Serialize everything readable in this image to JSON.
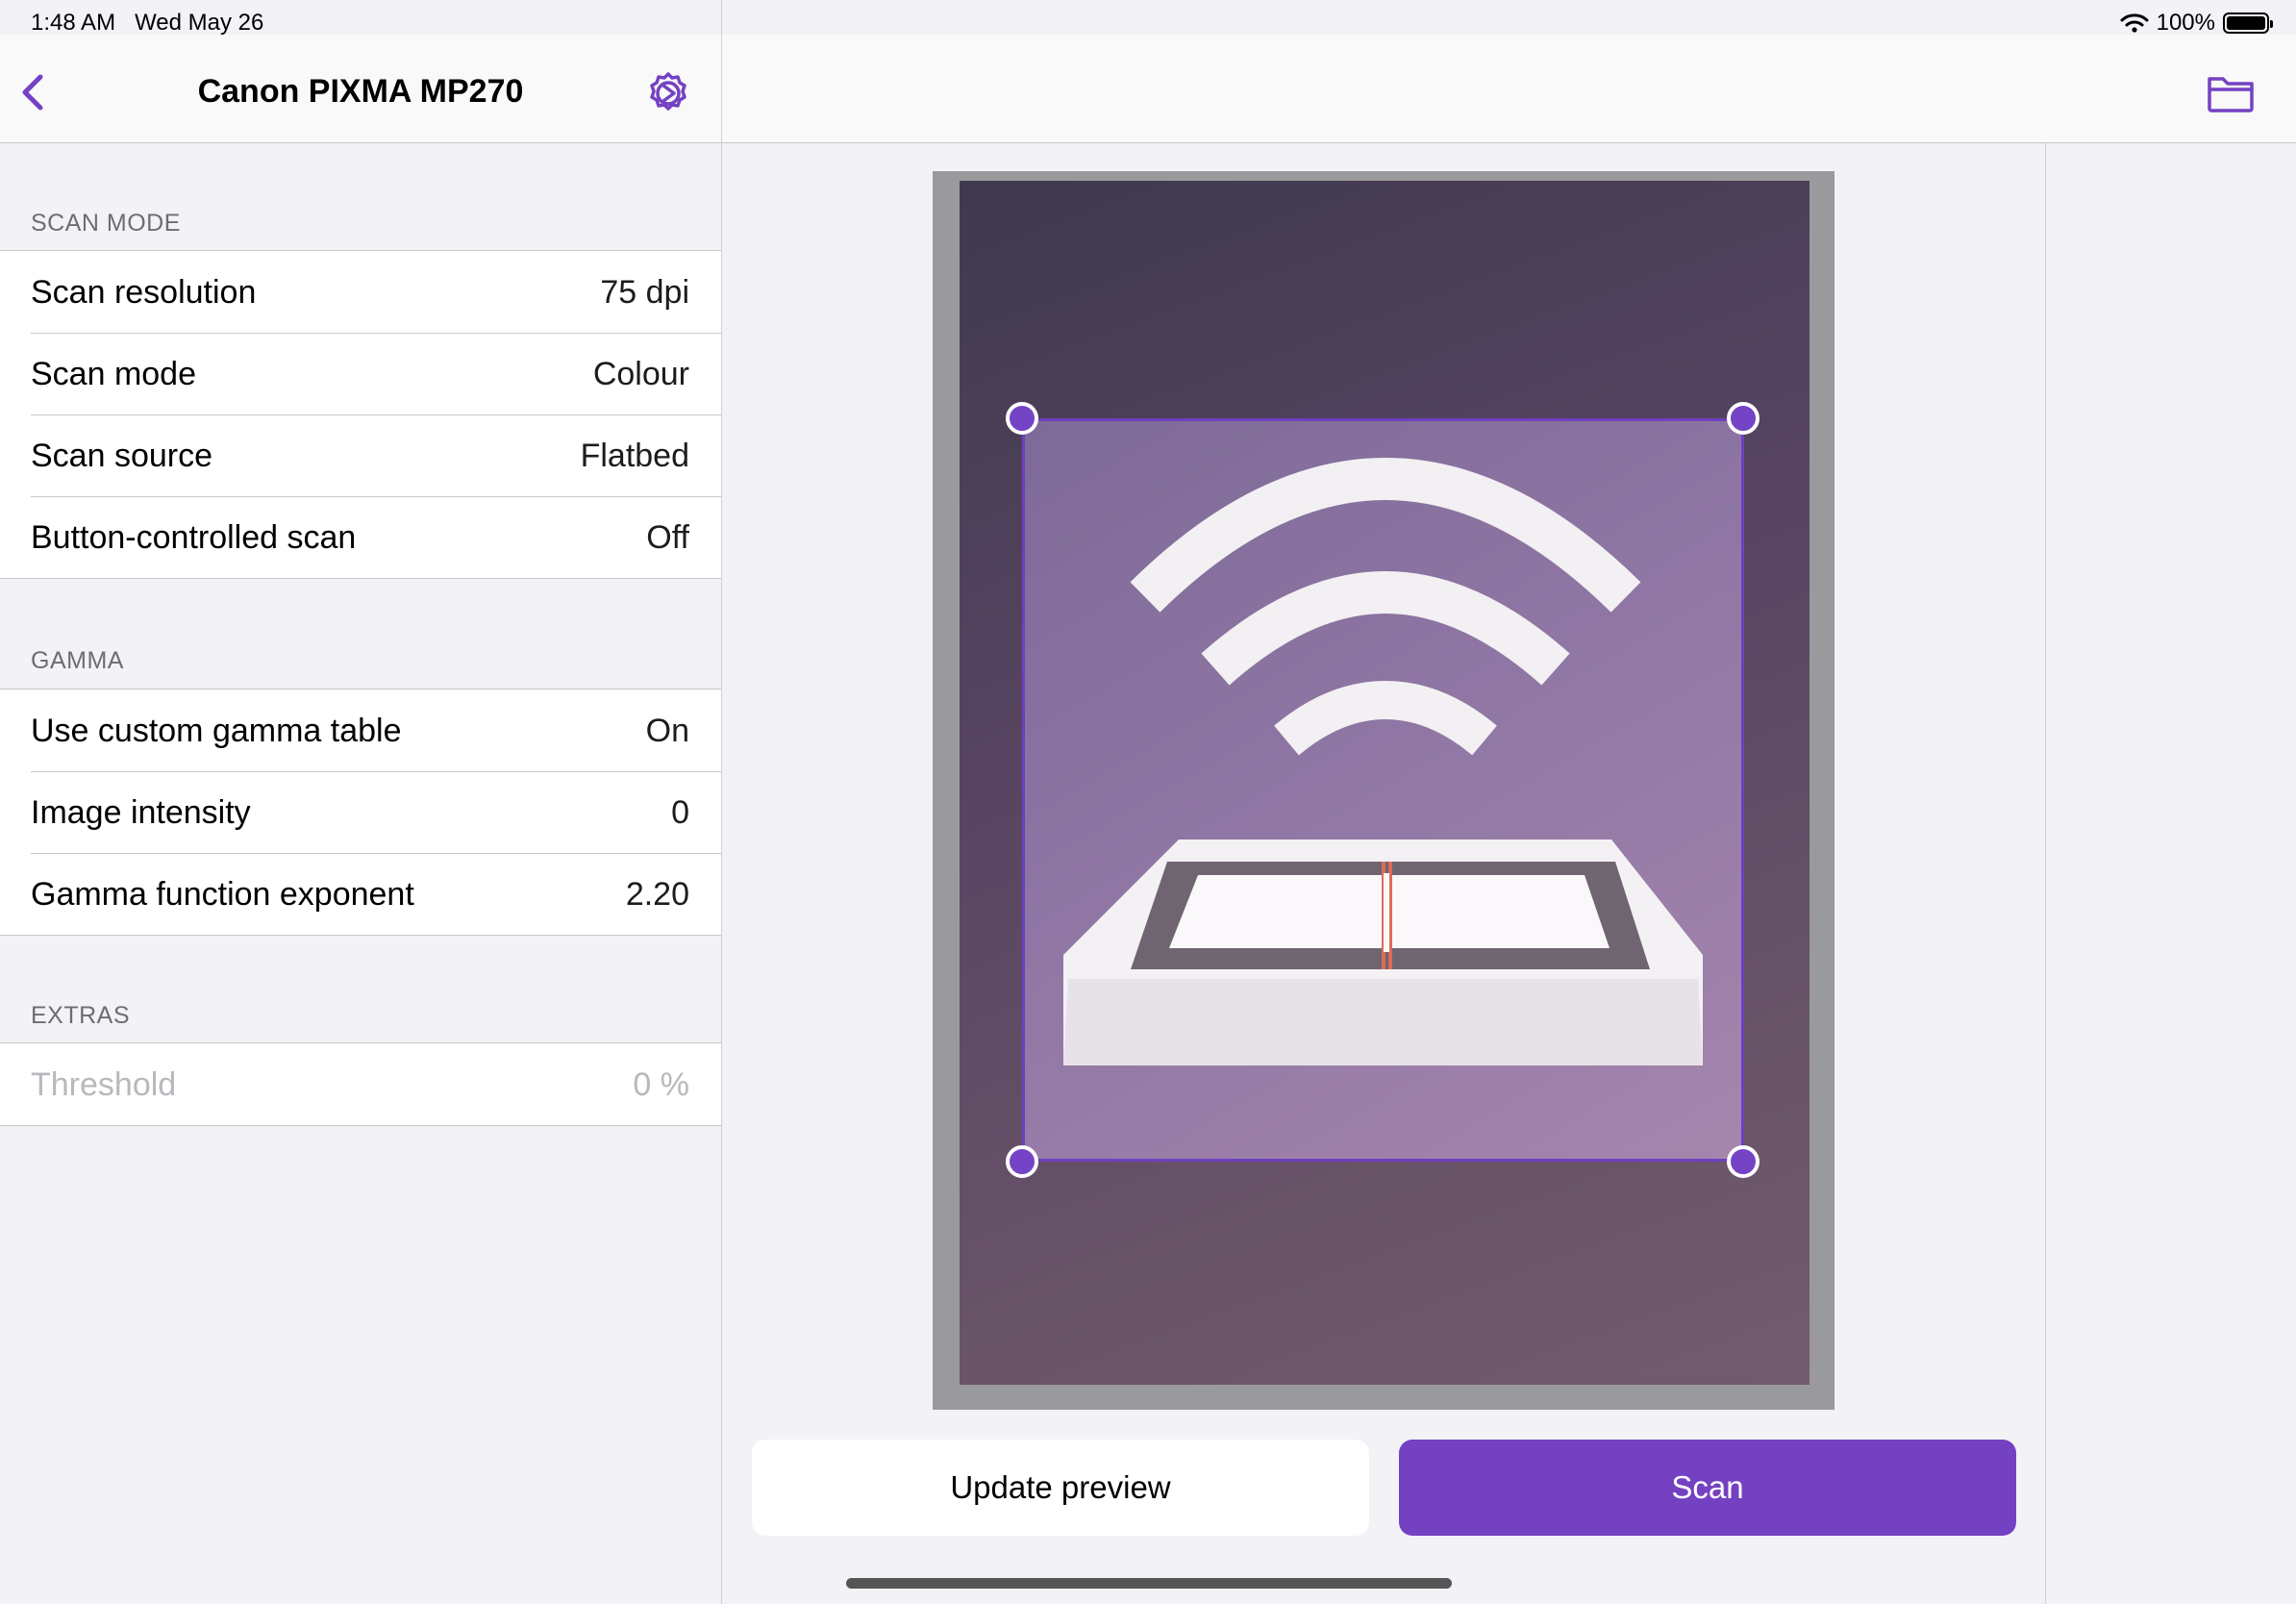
{
  "status_bar": {
    "time": "1:48 AM",
    "date": "Wed May 26",
    "battery": "100%"
  },
  "sidebar": {
    "title": "Canon PIXMA MP270",
    "sections": [
      {
        "header": "SCAN MODE",
        "rows": [
          {
            "label": "Scan resolution",
            "value": "75 dpi"
          },
          {
            "label": "Scan mode",
            "value": "Colour"
          },
          {
            "label": "Scan source",
            "value": "Flatbed"
          },
          {
            "label": "Button-controlled scan",
            "value": "Off"
          }
        ]
      },
      {
        "header": "GAMMA",
        "rows": [
          {
            "label": "Use custom gamma table",
            "value": "On"
          },
          {
            "label": "Image intensity",
            "value": "0"
          },
          {
            "label": "Gamma function exponent",
            "value": "2.20"
          }
        ]
      },
      {
        "header": "EXTRAS",
        "rows": [
          {
            "label": "Threshold",
            "value": "0 %",
            "disabled": true
          }
        ]
      }
    ]
  },
  "main": {
    "update_preview_label": "Update preview",
    "scan_label": "Scan"
  },
  "colors": {
    "accent": "#7441c3",
    "background": "#f2f2f7"
  },
  "icons": [
    "back-chevron-icon",
    "settings-gear-icon",
    "folder-icon",
    "wifi-icon",
    "battery-icon"
  ]
}
